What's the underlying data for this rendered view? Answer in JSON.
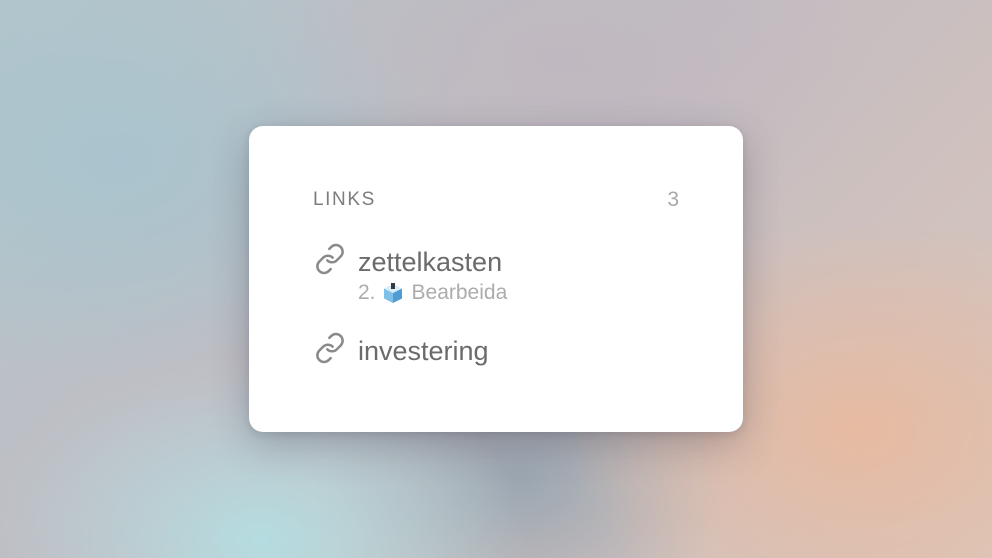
{
  "panel": {
    "title": "LINKS",
    "count": "3",
    "links": [
      {
        "title": "zettelkasten",
        "sub_index": "2.",
        "sub_icon": "box-icon",
        "sub_label": "Bearbeida"
      },
      {
        "title": "investering"
      }
    ]
  },
  "colors": {
    "card_bg": "#ffffff",
    "title_text": "#6b6b6b",
    "muted_text": "#acacac",
    "header_text": "#7d7d7d",
    "box_icon_blue": "#5aa6d6"
  }
}
